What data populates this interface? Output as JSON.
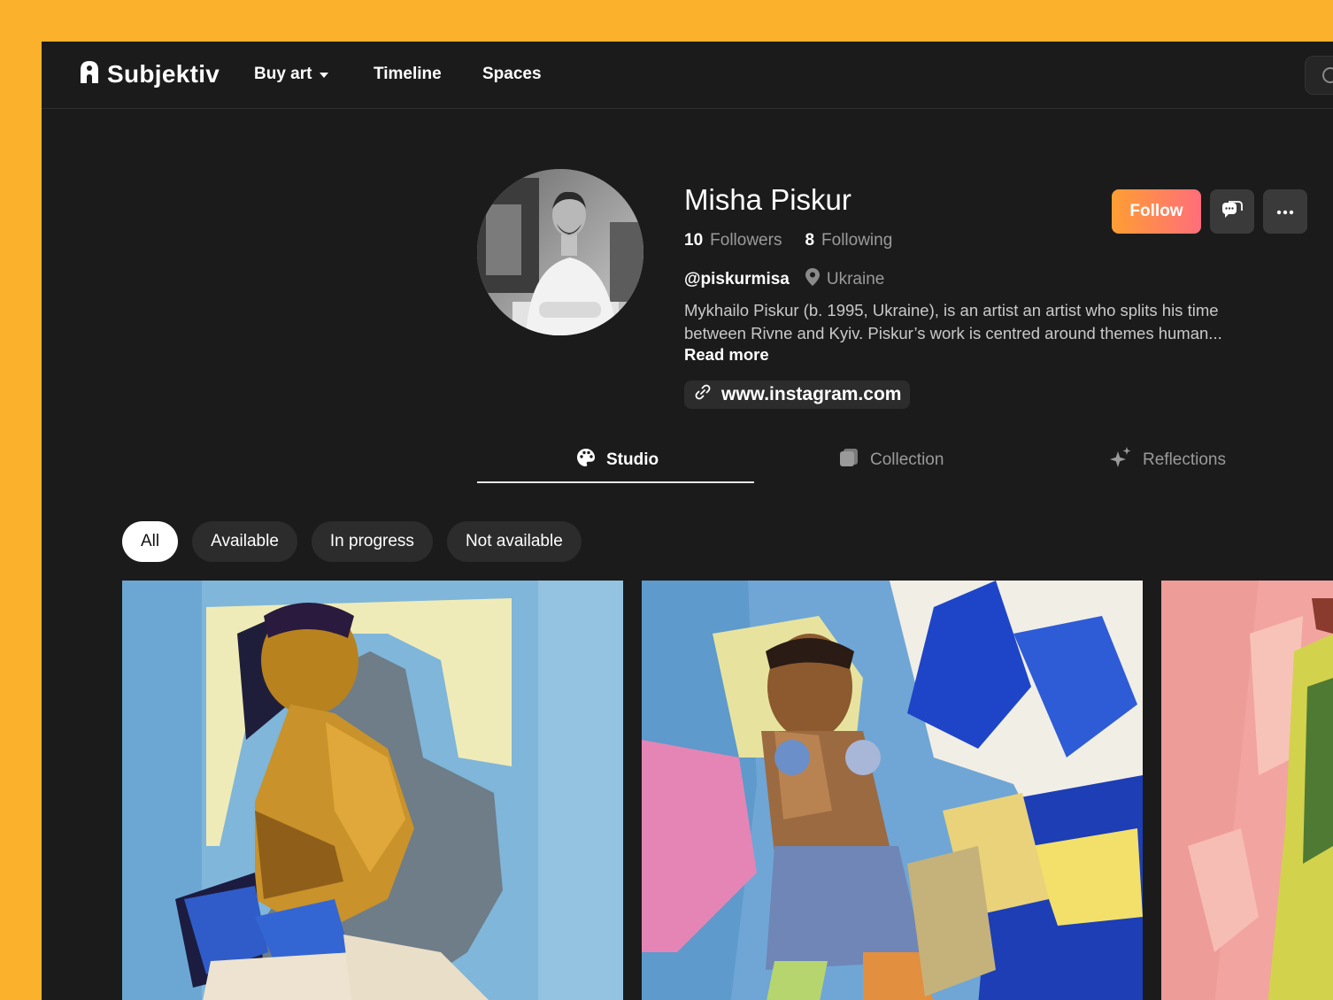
{
  "app": {
    "brand": "Subjektiv",
    "nav": [
      {
        "label": "Buy art",
        "dropdown": true
      },
      {
        "label": "Timeline"
      },
      {
        "label": "Spaces"
      }
    ]
  },
  "profile": {
    "name": "Misha Piskur",
    "followers_count": "10",
    "followers_label": "Followers",
    "following_count": "8",
    "following_label": "Following",
    "handle": "@piskurmisa",
    "location": "Ukraine",
    "bio": "Mykhailo Piskur (b. 1995, Ukraine), is an artist an artist who splits his time between Rivne and Kyiv. Piskur’s work is centred around themes human...",
    "read_more": "Read more",
    "link": "www.instagram.com"
  },
  "actions": {
    "follow_label": "Follow",
    "message_icon": "chat-icon",
    "more_icon": "more-icon"
  },
  "tabs": [
    {
      "label": "Studio",
      "icon": "palette-icon",
      "active": true
    },
    {
      "label": "Collection",
      "icon": "collection-icon",
      "active": false
    },
    {
      "label": "Reflections",
      "icon": "sparkle-icon",
      "active": false
    }
  ],
  "filters": [
    {
      "label": "All",
      "active": true
    },
    {
      "label": "Available",
      "active": false
    },
    {
      "label": "In progress",
      "active": false
    },
    {
      "label": "Not available",
      "active": false
    }
  ],
  "colors": {
    "frame": "#FBB12B",
    "background": "#1B1B1B",
    "follow_gradient_start": "#FF9E33",
    "follow_gradient_end": "#FF6E7A"
  }
}
